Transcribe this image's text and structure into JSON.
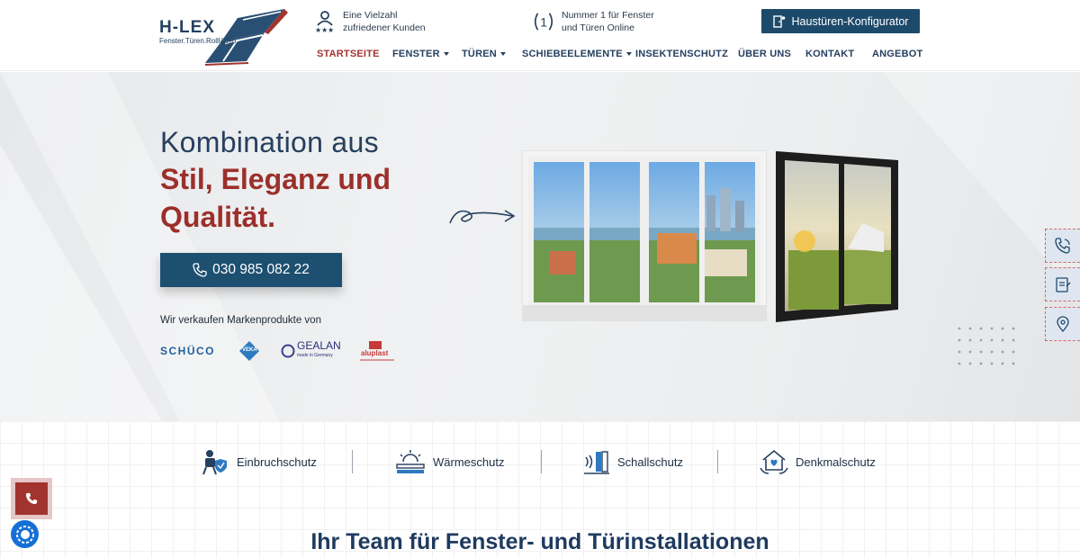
{
  "header": {
    "logo": {
      "word": "H-LEX",
      "tagline": "Fenster.Türen.Rollläden"
    },
    "usp": [
      {
        "icon": "customers-icon",
        "line1": "Eine Vielzahl",
        "line2": "zufriedener Kunden"
      },
      {
        "icon": "number-one-icon",
        "line1": "Nummer 1 für Fenster",
        "line2": "und Türen Online"
      }
    ],
    "cta_label": "Haustüren-Konfigurator",
    "nav": [
      {
        "label": "STARTSEITE",
        "active": true,
        "dropdown": false
      },
      {
        "label": "FENSTER",
        "active": false,
        "dropdown": true
      },
      {
        "label": "TÜREN",
        "active": false,
        "dropdown": true
      },
      {
        "label": "SCHIEBEELEMENTE",
        "active": false,
        "dropdown": true
      },
      {
        "label": "INSEKTENSCHUTZ",
        "active": false,
        "dropdown": false
      },
      {
        "label": "ÜBER UNS",
        "active": false,
        "dropdown": false
      },
      {
        "label": "KONTAKT",
        "active": false,
        "dropdown": false
      },
      {
        "label": "ANGEBOT",
        "active": false,
        "dropdown": false
      }
    ]
  },
  "hero": {
    "line1": "Kombination aus",
    "line2": "Stil, Eleganz und",
    "line3": "Qualität.",
    "phone": "030 985 082 22",
    "brands_text": "Wir verkaufen Markenprodukte von",
    "brands": [
      {
        "name": "SCHÜCO"
      },
      {
        "name": "VEKA"
      },
      {
        "name": "GEALAN",
        "sub": "made in Germany"
      },
      {
        "name": "aluplast"
      }
    ]
  },
  "side_buttons": [
    "phone-call-icon",
    "quote-form-icon",
    "location-pin-icon"
  ],
  "features": [
    {
      "label": "Einbruchschutz",
      "icon": "burglar-icon"
    },
    {
      "label": "Wärmeschutz",
      "icon": "sun-heat-icon"
    },
    {
      "label": "Schallschutz",
      "icon": "sound-icon"
    },
    {
      "label": "Denkmalschutz",
      "icon": "heritage-house-icon"
    }
  ],
  "section_title": "Ihr Team für Fenster- und Türinstallationen",
  "colors": {
    "primary": "#1d4a6b",
    "accent": "#a2342f",
    "text": "#26405f"
  }
}
